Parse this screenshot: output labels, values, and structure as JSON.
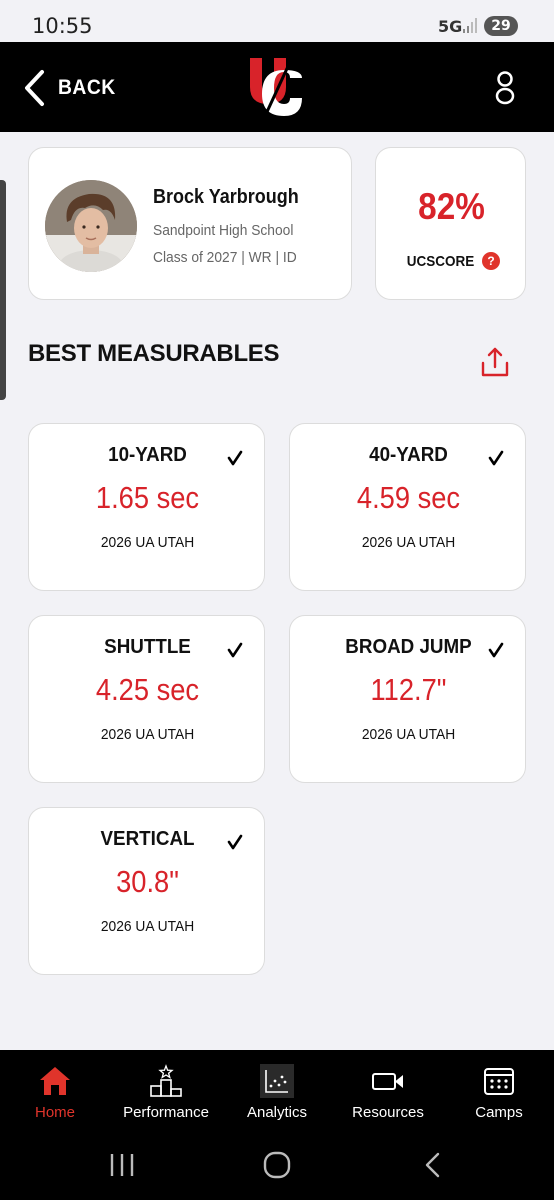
{
  "status_bar": {
    "time": "10:55",
    "network": "5G",
    "battery": "29"
  },
  "header": {
    "back_label": "BACK",
    "logo": "UC"
  },
  "player": {
    "name": "Brock Yarbrough",
    "school": "Sandpoint High School",
    "details": "Class of 2027 | WR | ID"
  },
  "ucscore": {
    "value": "82%",
    "label": "UCSCORE",
    "help_glyph": "?"
  },
  "section_title": "BEST MEASURABLES",
  "measurables": [
    {
      "name": "10-YARD",
      "value": "1.65 sec",
      "event": "2026 UA UTAH"
    },
    {
      "name": "40-YARD",
      "value": "4.59 sec",
      "event": "2026 UA UTAH"
    },
    {
      "name": "SHUTTLE",
      "value": "4.25 sec",
      "event": "2026 UA UTAH"
    },
    {
      "name": "BROAD JUMP",
      "value": "112.7\"",
      "event": "2026 UA UTAH"
    },
    {
      "name": "VERTICAL",
      "value": "30.8\"",
      "event": "2026 UA UTAH"
    }
  ],
  "bottom_nav": [
    {
      "label": "Home",
      "icon": "home-icon",
      "active": true
    },
    {
      "label": "Performance",
      "icon": "podium-icon",
      "active": false
    },
    {
      "label": "Analytics",
      "icon": "scatter-chart-icon",
      "active": false
    },
    {
      "label": "Resources",
      "icon": "video-camera-icon",
      "active": false
    },
    {
      "label": "Camps",
      "icon": "calendar-icon",
      "active": false
    }
  ],
  "colors": {
    "accent": "#d8232a",
    "header_bg": "#000000",
    "page_bg": "#f2f2f6"
  }
}
